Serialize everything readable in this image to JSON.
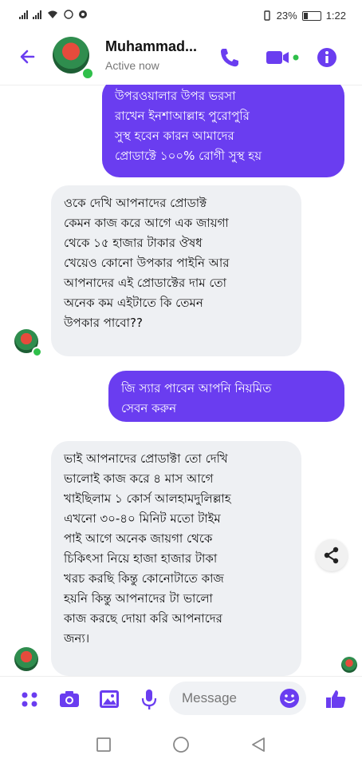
{
  "status_bar": {
    "battery_percent": "23%",
    "time": "1:22"
  },
  "header": {
    "contact_name": "Muhammad...",
    "presence": "Active now",
    "icons": [
      "back-arrow-icon",
      "phone-icon",
      "video-call-icon",
      "info-icon"
    ],
    "accent_color": "#6a3df0"
  },
  "messages": [
    {
      "direction": "outgoing",
      "text": "উপরওয়ালার উপর ভরসা\nরাখেন ইনশাআল্লাহ পুরোপুরি\nসুস্থ হবেন কারন আমাদের\nপ্রোডাক্টে ১০০% রোগী সুস্থ হয়"
    },
    {
      "direction": "incoming",
      "text": "ওকে দেখি আপনাদের প্রোডাক্ট\nকেমন কাজ করে আগে এক জায়গা\nথেকে ১৫ হাজার টাকার ঔষধ\nখেয়েও কোনো উপকার পাইনি আর\nআপনাদের এই প্রোডাক্টের দাম তো\nঅনেক কম এইটাতে কি তেমন\nউপকার পাবো??"
    },
    {
      "direction": "outgoing",
      "text": "জি স্যার পাবেন আপনি নিয়মিত\nসেবন করুন"
    },
    {
      "direction": "incoming",
      "text": "ভাই আপনাদের প্রোডাক্টা তো দেখি\nভালোই কাজ করে ৪ মাস আগে\nখাইছিলাম ১ কোর্স আলহামদুলিল্লাহ\nএখনো ৩০-৪০ মিনিট মতো টাইম\nপাই আগে অনেক জায়গা থেকে\nচিকিৎসা নিয়ে হাজা হাজার টাকা\nখরচ করছি কিন্তু কোনোটাতে কাজ\nহয়নি কিন্তু আপনাদের টা ভালো\nকাজ করছে দোয়া করি আপনাদের\nজন্য।"
    }
  ],
  "composer": {
    "placeholder": "Message",
    "icons": [
      "menu-dots-icon",
      "camera-icon",
      "gallery-icon",
      "microphone-icon",
      "emoji-icon",
      "like-icon"
    ]
  },
  "nav_bar": {
    "icons": [
      "recents-square-icon",
      "home-circle-icon",
      "back-triangle-icon"
    ]
  }
}
